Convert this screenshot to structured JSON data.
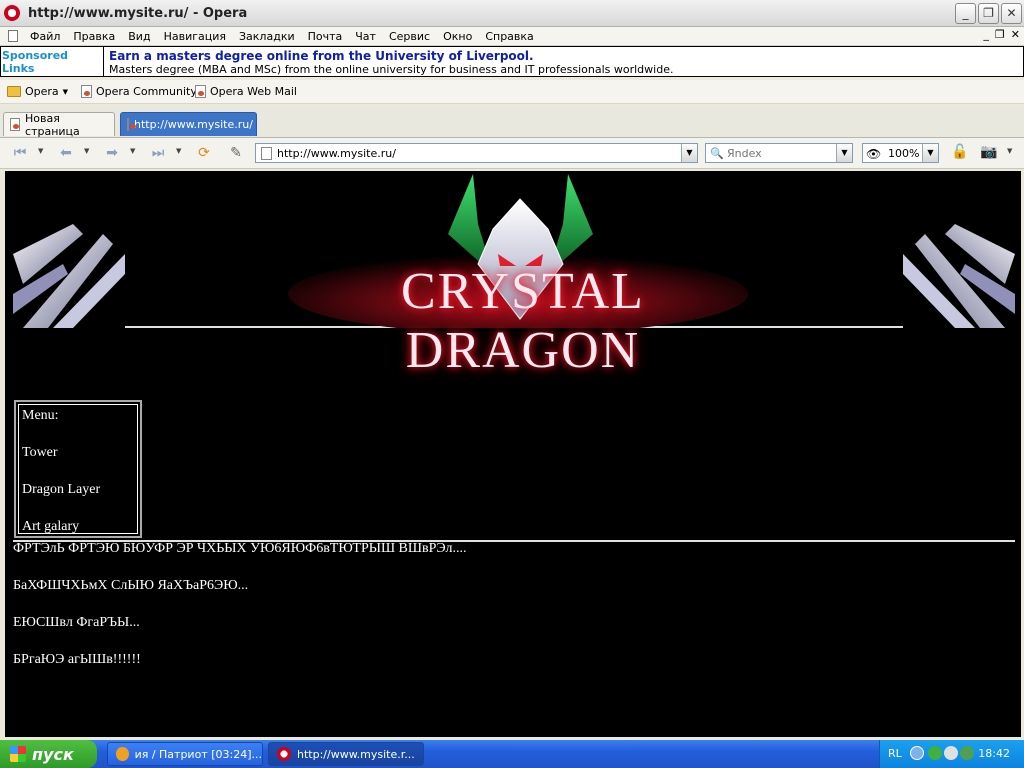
{
  "window": {
    "title": "http://www.mysite.ru/ - Opera"
  },
  "menubar": {
    "items": [
      "Файл",
      "Правка",
      "Вид",
      "Навигация",
      "Закладки",
      "Почта",
      "Чат",
      "Сервис",
      "Окно",
      "Справка"
    ]
  },
  "ad": {
    "sponsored": "Sponsored Links",
    "headline": "Earn a masters degree online from the University of Liverpool.",
    "subtitle": "Masters degree (MBA and MSc) from the online university for business and IT professionals worldwide."
  },
  "personal_bar": {
    "items": [
      "Opera",
      "Opera Community",
      "Opera Web Mail"
    ]
  },
  "tabs": [
    {
      "label": "Новая страница",
      "active": false
    },
    {
      "label": "http://www.mysite.ru/",
      "active": true
    }
  ],
  "address": {
    "url": "http://www.mysite.ru/"
  },
  "search": {
    "placeholder": "Яndex"
  },
  "zoom": {
    "value": "100%"
  },
  "page": {
    "logo_text": "CRYSTAL DRAGON",
    "menu_label": "Menu:",
    "menu_items": [
      "Tower",
      "Dragon Layer",
      "Art galary"
    ],
    "paragraphs": [
      "ФРТЭлЬ ФРТЭЮ БЮУФР ЭР ЧХЬЫХ УЮ6ЯЮФ6вТЮТРЫШ ВШвРЭл....",
      "БаХФШЧХЬмХ СлЫЮ ЯаХЪаР6ЭЮ...",
      "ЕЮСШвл ФгаРЪЫ...",
      "БРгаЮЭ агЫШв!!!!!!"
    ]
  },
  "taskbar": {
    "start_label": "пуск",
    "tasks": [
      {
        "label": "ия / Патриот [03:24]...",
        "active": false
      },
      {
        "label": "http://www.mysite.r...",
        "active": true
      }
    ],
    "lang": "RL",
    "clock": "18:42"
  },
  "colors": {
    "page_background": "#000000",
    "tab_active": "#3d75c8",
    "ad_headline": "#1020a8",
    "sponsored": "#1a8fd0",
    "taskbar": "#245edb",
    "start_button": "#2f9a2a"
  }
}
